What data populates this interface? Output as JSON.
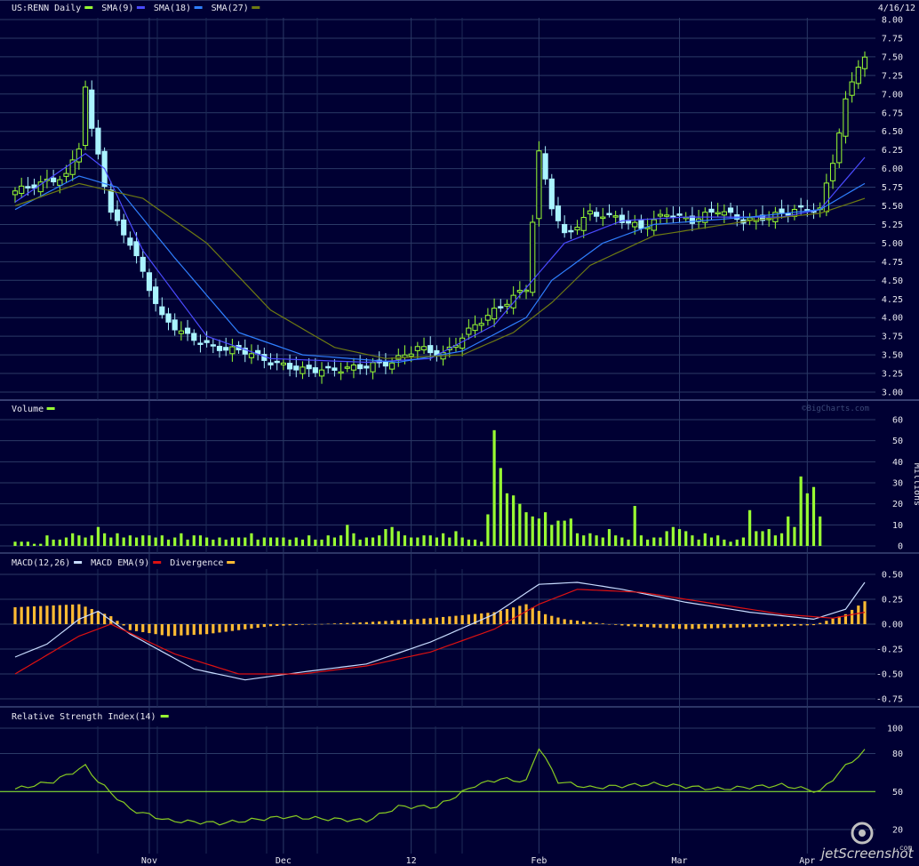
{
  "header": {
    "symbol_label": "US:RENN Daily",
    "date": "4/16/12",
    "watermark": "©BigCharts.com"
  },
  "colors": {
    "background": "#000033",
    "grid": "#2b3a66",
    "up": "#99ff33",
    "down": "#aaf4ff",
    "sma9": "#4a4aff",
    "sma18": "#2f7fff",
    "sma27": "#6e7a12",
    "macd": "#c8dcff",
    "macd_ema": "#dd1111",
    "divergence": "#ffbb33",
    "volume": "#99ff33",
    "rsi": "#88cc22",
    "rsi_ref": "#99ff33"
  },
  "x_axis": {
    "labels": [
      "Nov",
      "Dec",
      "12",
      "Feb",
      "Mar",
      "Apr"
    ],
    "label_days": [
      21,
      42,
      62,
      82,
      104,
      124
    ]
  },
  "panels": {
    "price": {
      "legend": [
        {
          "text": "US:RENN Daily",
          "color": "#99ff33"
        },
        {
          "text": "SMA(9)",
          "color": "#4a4aff"
        },
        {
          "text": "SMA(18)",
          "color": "#2f7fff"
        },
        {
          "text": "SMA(27)",
          "color": "#6e7a12"
        }
      ],
      "y_ticks": [
        "8.00",
        "7.75",
        "7.50",
        "7.25",
        "7.00",
        "6.75",
        "6.50",
        "6.25",
        "6.00",
        "5.75",
        "5.50",
        "5.25",
        "5.00",
        "4.75",
        "4.50",
        "4.25",
        "4.00",
        "3.75",
        "3.50",
        "3.25",
        "3.00"
      ]
    },
    "volume": {
      "legend": [
        {
          "text": "Volume",
          "color": "#99ff33"
        }
      ],
      "y_ticks": [
        "60",
        "50",
        "40",
        "30",
        "20",
        "10",
        "0"
      ],
      "unit_label": "Millions"
    },
    "macd": {
      "legend": [
        {
          "text": "MACD(12,26)",
          "color": "#c8dcff"
        },
        {
          "text": "MACD EMA(9)",
          "color": "#dd1111"
        },
        {
          "text": "Divergence",
          "color": "#ffbb33"
        }
      ],
      "y_ticks": [
        "0.50",
        "0.25",
        "0.00",
        "-0.25",
        "-0.50",
        "-0.75"
      ]
    },
    "rsi": {
      "legend": [
        {
          "text": "Relative Strength Index(14)",
          "color": "#99ff33"
        }
      ],
      "y_ticks": [
        "100",
        "80",
        "50",
        "20"
      ]
    }
  },
  "branding": {
    "text": "jetScreenshot",
    "suffix": ".com"
  },
  "chart_data": [
    {
      "type": "candlestick",
      "title": "US:RENN Daily",
      "ylim": [
        3.0,
        8.0
      ],
      "ohlc_anchors": [
        [
          0,
          5.7
        ],
        [
          8,
          5.9
        ],
        [
          10,
          6.3
        ],
        [
          11,
          7.1
        ],
        [
          12,
          6.5
        ],
        [
          13,
          6.2
        ],
        [
          15,
          5.4
        ],
        [
          18,
          5.0
        ],
        [
          20,
          4.6
        ],
        [
          23,
          4.0
        ],
        [
          27,
          3.75
        ],
        [
          31,
          3.6
        ],
        [
          36,
          3.55
        ],
        [
          40,
          3.4
        ],
        [
          45,
          3.3
        ],
        [
          50,
          3.3
        ],
        [
          55,
          3.35
        ],
        [
          59,
          3.4
        ],
        [
          63,
          3.6
        ],
        [
          67,
          3.5
        ],
        [
          72,
          3.9
        ],
        [
          76,
          4.15
        ],
        [
          80,
          4.4
        ],
        [
          82,
          6.2
        ],
        [
          84,
          5.5
        ],
        [
          86,
          5.1
        ],
        [
          90,
          5.4
        ],
        [
          94,
          5.35
        ],
        [
          98,
          5.2
        ],
        [
          102,
          5.4
        ],
        [
          106,
          5.3
        ],
        [
          110,
          5.45
        ],
        [
          114,
          5.3
        ],
        [
          118,
          5.35
        ],
        [
          122,
          5.45
        ],
        [
          126,
          5.45
        ],
        [
          128,
          6.1
        ],
        [
          130,
          6.9
        ],
        [
          132,
          7.4
        ],
        [
          133,
          7.5
        ]
      ],
      "series": [
        {
          "name": "SMA(9)",
          "values_anchors": [
            [
              0,
              5.55
            ],
            [
              11,
              6.2
            ],
            [
              14,
              6.0
            ],
            [
              20,
              4.9
            ],
            [
              30,
              3.75
            ],
            [
              40,
              3.45
            ],
            [
              55,
              3.4
            ],
            [
              65,
              3.45
            ],
            [
              75,
              3.9
            ],
            [
              82,
              4.6
            ],
            [
              86,
              5.0
            ],
            [
              95,
              5.3
            ],
            [
              105,
              5.35
            ],
            [
              120,
              5.35
            ],
            [
              126,
              5.45
            ],
            [
              133,
              6.15
            ]
          ]
        },
        {
          "name": "SMA(18)",
          "values_anchors": [
            [
              0,
              5.45
            ],
            [
              10,
              5.9
            ],
            [
              16,
              5.75
            ],
            [
              25,
              4.8
            ],
            [
              35,
              3.8
            ],
            [
              45,
              3.5
            ],
            [
              60,
              3.4
            ],
            [
              70,
              3.55
            ],
            [
              80,
              4.0
            ],
            [
              84,
              4.5
            ],
            [
              92,
              5.0
            ],
            [
              100,
              5.25
            ],
            [
              115,
              5.35
            ],
            [
              126,
              5.45
            ],
            [
              133,
              5.8
            ]
          ]
        },
        {
          "name": "SMA(27)",
          "values_anchors": [
            [
              0,
              5.5
            ],
            [
              10,
              5.8
            ],
            [
              20,
              5.6
            ],
            [
              30,
              5.0
            ],
            [
              40,
              4.1
            ],
            [
              50,
              3.6
            ],
            [
              58,
              3.45
            ],
            [
              70,
              3.5
            ],
            [
              78,
              3.8
            ],
            [
              84,
              4.2
            ],
            [
              90,
              4.7
            ],
            [
              100,
              5.1
            ],
            [
              115,
              5.3
            ],
            [
              126,
              5.4
            ],
            [
              133,
              5.6
            ]
          ]
        }
      ]
    },
    {
      "type": "bar",
      "title": "Volume",
      "ylabel": "Millions",
      "ylim": [
        0,
        60
      ],
      "values": [
        2,
        2,
        2,
        1,
        1,
        5,
        3,
        3,
        4,
        6,
        5,
        4,
        5,
        9,
        6,
        4,
        6,
        4,
        5,
        4,
        5,
        5,
        4,
        5,
        3,
        4,
        6,
        3,
        5,
        5,
        4,
        3,
        4,
        3,
        4,
        4,
        4,
        6,
        3,
        4,
        4,
        4,
        4,
        3,
        4,
        3,
        5,
        3,
        3,
        5,
        4,
        5,
        10,
        6,
        3,
        4,
        4,
        5,
        8,
        9,
        7,
        5,
        4,
        4,
        5,
        5,
        4,
        6,
        4,
        7,
        4,
        3,
        3,
        2,
        15,
        55,
        37,
        25,
        24,
        20,
        16,
        14,
        13,
        16,
        10,
        12,
        12,
        13,
        6,
        5,
        6,
        5,
        4,
        8,
        5,
        4,
        3,
        19,
        5,
        3,
        4,
        4,
        7,
        9,
        8,
        7,
        5,
        3,
        6,
        4,
        5,
        3,
        2,
        3,
        4,
        17,
        7,
        7,
        8,
        5,
        6,
        14,
        9,
        33,
        25,
        28,
        14
      ]
    },
    {
      "type": "line",
      "title": "MACD(12,26)",
      "ylim": [
        -0.75,
        0.5
      ],
      "series": [
        {
          "name": "MACD(12,26)",
          "values_anchors": [
            [
              0,
              -0.33
            ],
            [
              5,
              -0.2
            ],
            [
              10,
              0.05
            ],
            [
              13,
              0.13
            ],
            [
              18,
              -0.1
            ],
            [
              28,
              -0.45
            ],
            [
              36,
              -0.56
            ],
            [
              45,
              -0.48
            ],
            [
              55,
              -0.4
            ],
            [
              65,
              -0.18
            ],
            [
              75,
              0.1
            ],
            [
              82,
              0.4
            ],
            [
              88,
              0.42
            ],
            [
              95,
              0.35
            ],
            [
              105,
              0.22
            ],
            [
              115,
              0.12
            ],
            [
              125,
              0.05
            ],
            [
              130,
              0.15
            ],
            [
              133,
              0.42
            ]
          ]
        },
        {
          "name": "MACD EMA(9)",
          "values_anchors": [
            [
              0,
              -0.5
            ],
            [
              10,
              -0.12
            ],
            [
              15,
              0.0
            ],
            [
              25,
              -0.3
            ],
            [
              35,
              -0.5
            ],
            [
              45,
              -0.5
            ],
            [
              55,
              -0.42
            ],
            [
              65,
              -0.28
            ],
            [
              75,
              -0.05
            ],
            [
              82,
              0.2
            ],
            [
              88,
              0.35
            ],
            [
              98,
              0.32
            ],
            [
              110,
              0.2
            ],
            [
              120,
              0.1
            ],
            [
              128,
              0.06
            ],
            [
              133,
              0.12
            ]
          ]
        },
        {
          "name": "Divergence",
          "type": "bar",
          "values_anchors": [
            [
              0,
              0.17
            ],
            [
              10,
              0.2
            ],
            [
              15,
              0.08
            ],
            [
              18,
              -0.06
            ],
            [
              24,
              -0.12
            ],
            [
              30,
              -0.1
            ],
            [
              40,
              -0.02
            ],
            [
              55,
              0.02
            ],
            [
              65,
              0.06
            ],
            [
              75,
              0.12
            ],
            [
              80,
              0.2
            ],
            [
              83,
              0.1
            ],
            [
              86,
              0.05
            ],
            [
              90,
              0.02
            ],
            [
              96,
              -0.02
            ],
            [
              105,
              -0.05
            ],
            [
              115,
              -0.03
            ],
            [
              125,
              -0.01
            ],
            [
              130,
              0.1
            ],
            [
              133,
              0.23
            ]
          ]
        }
      ]
    },
    {
      "type": "line",
      "title": "Relative Strength Index(14)",
      "ylim": [
        0,
        100
      ],
      "reference_line": 50,
      "series": [
        {
          "name": "Relative Strength Index(14)",
          "values_anchors": [
            [
              0,
              52
            ],
            [
              6,
              58
            ],
            [
              11,
              70
            ],
            [
              13,
              58
            ],
            [
              18,
              36
            ],
            [
              24,
              27
            ],
            [
              32,
              25
            ],
            [
              42,
              30
            ],
            [
              55,
              27
            ],
            [
              60,
              38
            ],
            [
              66,
              38
            ],
            [
              72,
              55
            ],
            [
              76,
              60
            ],
            [
              80,
              58
            ],
            [
              82,
              85
            ],
            [
              85,
              58
            ],
            [
              90,
              53
            ],
            [
              100,
              56
            ],
            [
              110,
              52
            ],
            [
              120,
              55
            ],
            [
              126,
              50
            ],
            [
              130,
              70
            ],
            [
              133,
              82
            ]
          ]
        }
      ]
    }
  ]
}
